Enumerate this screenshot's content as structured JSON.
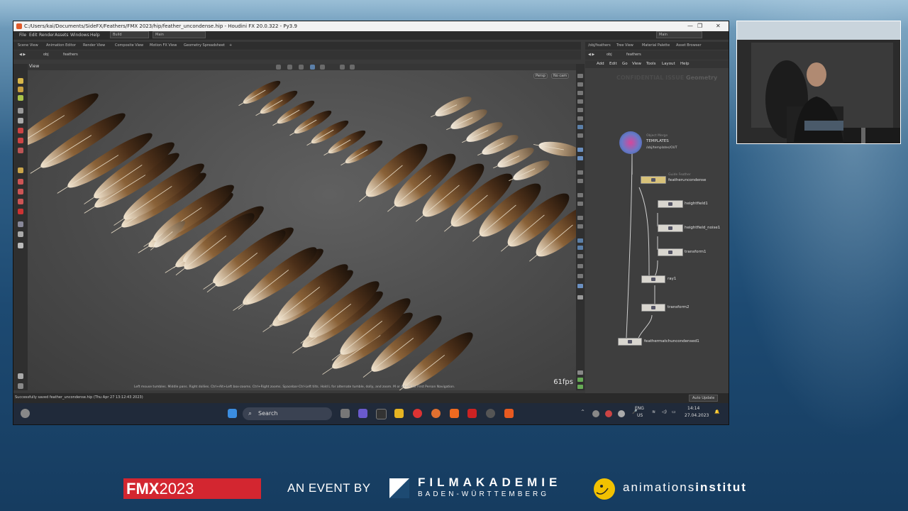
{
  "window": {
    "title": "C:/Users/kai/Documents/SideFX/Feathers/FMX 2023/hip/feather_uncondense.hip - Houdini FX 20.0.322 - Py3.9",
    "controls": [
      "—",
      "❐",
      "✕"
    ]
  },
  "menu": {
    "items": [
      "File",
      "Edit",
      "Render",
      "Assets",
      "Windows",
      "Help"
    ],
    "desktop_select": "Build",
    "workspace_select": "Main",
    "workspace_select_right": "Main"
  },
  "viewer_tabs": [
    "Scene View",
    "Animation Editor",
    "Render View",
    "Composite View",
    "Motion FX View",
    "Geometry Spreadsheet"
  ],
  "viewer_path": {
    "root": "obj",
    "node": "feathers"
  },
  "viewport": {
    "label": "View",
    "persp": "Persp",
    "cam": "No cam",
    "fps": "61fps",
    "hint": "Left mouse tumbles. Middle pans. Right dollies. Ctrl+Alt+Left box-zooms. Ctrl+Right zooms. Spacebar-Ctrl-Left tilts. Hold L for alternate tumble, dolly, and zoom. M or Alt+M for First Person Navigation."
  },
  "network": {
    "tabs": [
      "/obj/feathers",
      "Tree View",
      "Material Palette",
      "Asset Browser"
    ],
    "path_root": "obj",
    "path_node": "feathers",
    "menu": [
      "Add",
      "Edit",
      "Go",
      "View",
      "Tools",
      "Layout",
      "Help"
    ],
    "watermark_left": "CONFIDENTIAL ISSUE",
    "watermark_right": "Geometry",
    "nodes": [
      {
        "id": "templates",
        "type": "Object Merge",
        "name": "TEMPLATES",
        "sub": "/obj/templates/OUT"
      },
      {
        "id": "featheruncondense",
        "type": "Guide Feather",
        "name": "featheruncondense"
      },
      {
        "id": "heightfield1",
        "name": "heightfield1"
      },
      {
        "id": "heightfield_noise1",
        "name": "heightfield_noise1"
      },
      {
        "id": "transform1",
        "name": "transform1"
      },
      {
        "id": "ray1",
        "name": "ray1"
      },
      {
        "id": "transform2",
        "name": "transform2"
      },
      {
        "id": "feathermatchuncondensed1",
        "name": "feathermatchuncondensed1"
      }
    ]
  },
  "statusbar": {
    "message": "Successfully saved feather_uncondense.hip (Thu Apr 27 13:12:43 2023)",
    "auto_update": "Auto Update"
  },
  "taskbar": {
    "search": "Search",
    "lang": "ENG",
    "region": "US",
    "time": "14:14",
    "date": "27.04.2023"
  },
  "banner": {
    "fmx_a": "FMX",
    "fmx_b": "2023",
    "event_by": "AN EVENT BY",
    "filmakademie": "FILMAKADEMIE",
    "filmakademie_sub": "BADEN-WÜRTTEMBERG",
    "ai_a": "animations",
    "ai_b": "institut"
  },
  "colors": {
    "fmx_red": "#d32630",
    "ai_yellow": "#f2c100",
    "houdini_orange": "#e05a2a"
  }
}
